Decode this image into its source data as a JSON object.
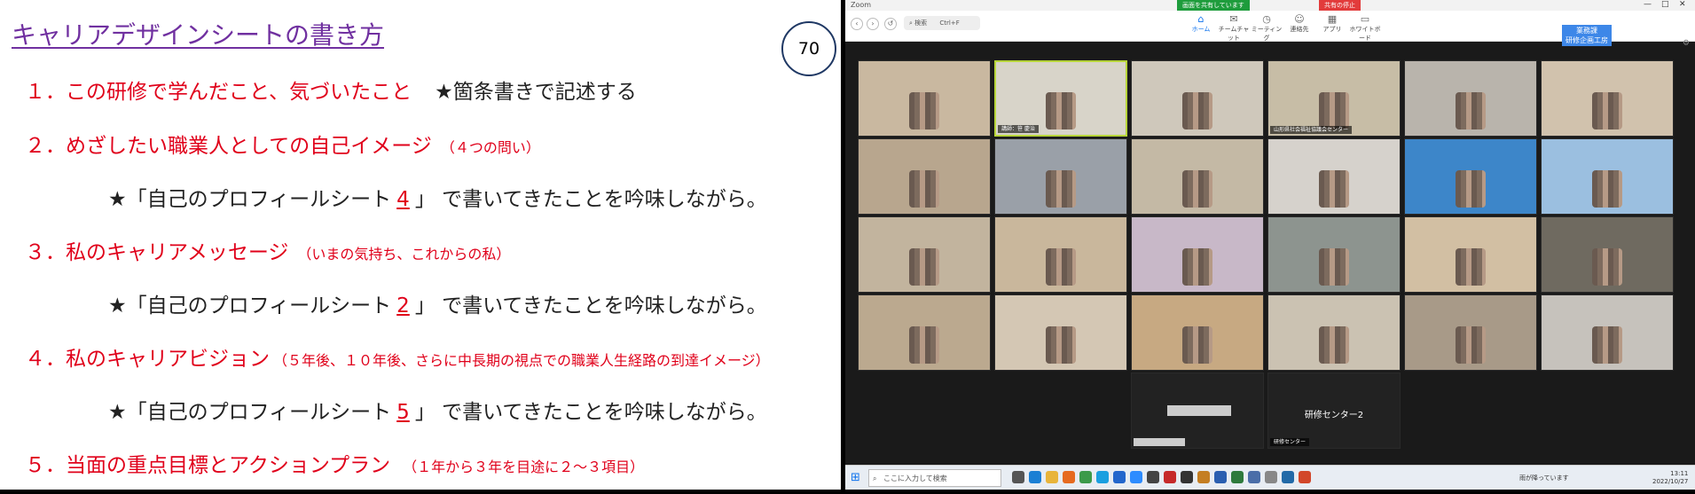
{
  "slide": {
    "title": "キャリアデザインシートの書き方",
    "page_number": "70",
    "items": [
      {
        "main": "１．この研修で学んだこと、気づいたこと",
        "sub": "",
        "note": "★箇条書きで記述する"
      },
      {
        "main": "２．めざしたい職業人としての自己イメージ",
        "sub": "（４つの問い）",
        "note": ""
      },
      {
        "main": "３．私のキャリアメッセージ",
        "sub": "（いまの気持ち、これからの私）",
        "note": ""
      },
      {
        "main": "４．私のキャリアビジョン",
        "sub": "（５年後、１０年後、さらに中長期の視点での職業人生経路の到達イメージ）",
        "note": ""
      },
      {
        "main": "５．当面の重点目標とアクションプラン",
        "sub": "（１年から３年を目途に２～３項目）",
        "note": ""
      }
    ],
    "star_lines": [
      {
        "prefix": "★「自己のプロフィールシート",
        "num": "4",
        "suffix": "」 で書いてきたことを吟味しながら。"
      },
      {
        "prefix": "★「自己のプロフィールシート",
        "num": "2",
        "suffix": "」 で書いてきたことを吟味しながら。"
      },
      {
        "prefix": "★「自己のプロフィールシート",
        "num": "5",
        "suffix": "」 で書いてきたことを吟味しながら。"
      }
    ]
  },
  "zoom": {
    "app_title": "Zoom",
    "share_banner": "画面を共有しています",
    "stop_share": "共有の停止",
    "window_controls": [
      "—",
      "□",
      "✕"
    ],
    "search_placeholder": "検索",
    "search_shortcut": "Ctrl+F",
    "toolbar": [
      {
        "label": "ホーム",
        "icon": "home-icon",
        "glyph": "⌂",
        "active": true
      },
      {
        "label": "チームチャット",
        "icon": "chat-icon",
        "glyph": "✉",
        "active": false
      },
      {
        "label": "ミーティング",
        "icon": "clock-icon",
        "glyph": "◷",
        "active": false
      },
      {
        "label": "連絡先",
        "icon": "contacts-icon",
        "glyph": "☺",
        "active": false
      },
      {
        "label": "アプリ",
        "icon": "apps-icon",
        "glyph": "▦",
        "active": false
      },
      {
        "label": "ホワイトボード",
        "icon": "whiteboard-icon",
        "glyph": "▭",
        "active": false
      }
    ],
    "blue_tag_lines": [
      "業務課",
      "研修企画工房"
    ],
    "tiles": [
      {
        "name": "",
        "bg": "#c9b8a0"
      },
      {
        "name": "講師：笹 慶治",
        "bg": "#d8d4c9",
        "highlight": true
      },
      {
        "name": "",
        "bg": "#cfc8bb"
      },
      {
        "name": "山形県社会福祉協議会センター",
        "bg": "#c7bda6"
      },
      {
        "name": "",
        "bg": "#b9b4ac"
      },
      {
        "name": "",
        "bg": "#d1c2ad"
      },
      {
        "name": "",
        "bg": "#b8a68e"
      },
      {
        "name": "",
        "bg": "#9aa0a8"
      },
      {
        "name": "",
        "bg": "#c4b9a5"
      },
      {
        "name": "",
        "bg": "#d6d2cc"
      },
      {
        "name": "",
        "bg": "#3d86c9"
      },
      {
        "name": "",
        "bg": "#9bbfe0"
      },
      {
        "name": "",
        "bg": "#c2b49e"
      },
      {
        "name": "",
        "bg": "#c9b79c"
      },
      {
        "name": "",
        "bg": "#c8b8c8"
      },
      {
        "name": "",
        "bg": "#8d948f"
      },
      {
        "name": "",
        "bg": "#d2bfa3"
      },
      {
        "name": "",
        "bg": "#6f6a60"
      },
      {
        "name": "",
        "bg": "#bba98f"
      },
      {
        "name": "",
        "bg": "#d4c7b4"
      },
      {
        "name": "",
        "bg": "#c7a982"
      },
      {
        "name": "",
        "bg": "#cbc2b2"
      },
      {
        "name": "",
        "bg": "#a89a88"
      },
      {
        "name": "",
        "bg": "#c6c2bc"
      }
    ],
    "dark_tiles": [
      {
        "name": ""
      },
      {
        "name": "研修センター2",
        "nameplate": "研修センター"
      }
    ],
    "taskbar": {
      "search_placeholder": "ここに入力して検索",
      "icons": [
        {
          "name": "task-view-icon",
          "color": "#555"
        },
        {
          "name": "edge-icon",
          "color": "#1a7fd4"
        },
        {
          "name": "explorer-icon",
          "color": "#e8b43a"
        },
        {
          "name": "firefox-icon",
          "color": "#e66a1f"
        },
        {
          "name": "chrome-icon",
          "color": "#3c9a4a"
        },
        {
          "name": "skype-icon",
          "color": "#1a9fe0"
        },
        {
          "name": "browser-icon",
          "color": "#2266cc"
        },
        {
          "name": "zoom-icon",
          "color": "#2d8cff"
        },
        {
          "name": "app-icon-1",
          "color": "#444"
        },
        {
          "name": "app-icon-2",
          "color": "#c62a2a"
        },
        {
          "name": "app-icon-3",
          "color": "#333"
        },
        {
          "name": "app-icon-4",
          "color": "#c47e22"
        },
        {
          "name": "app-icon-5",
          "color": "#2a5fb0"
        },
        {
          "name": "app-icon-6",
          "color": "#2e7a3c"
        },
        {
          "name": "app-icon-7",
          "color": "#4b6ea8"
        },
        {
          "name": "app-icon-8",
          "color": "#888"
        },
        {
          "name": "app-icon-9",
          "color": "#226aa8"
        },
        {
          "name": "powerpoint-icon",
          "color": "#d2472a"
        }
      ],
      "weather": "雨が降っています",
      "time": "13:11",
      "date": "2022/10/27"
    }
  }
}
